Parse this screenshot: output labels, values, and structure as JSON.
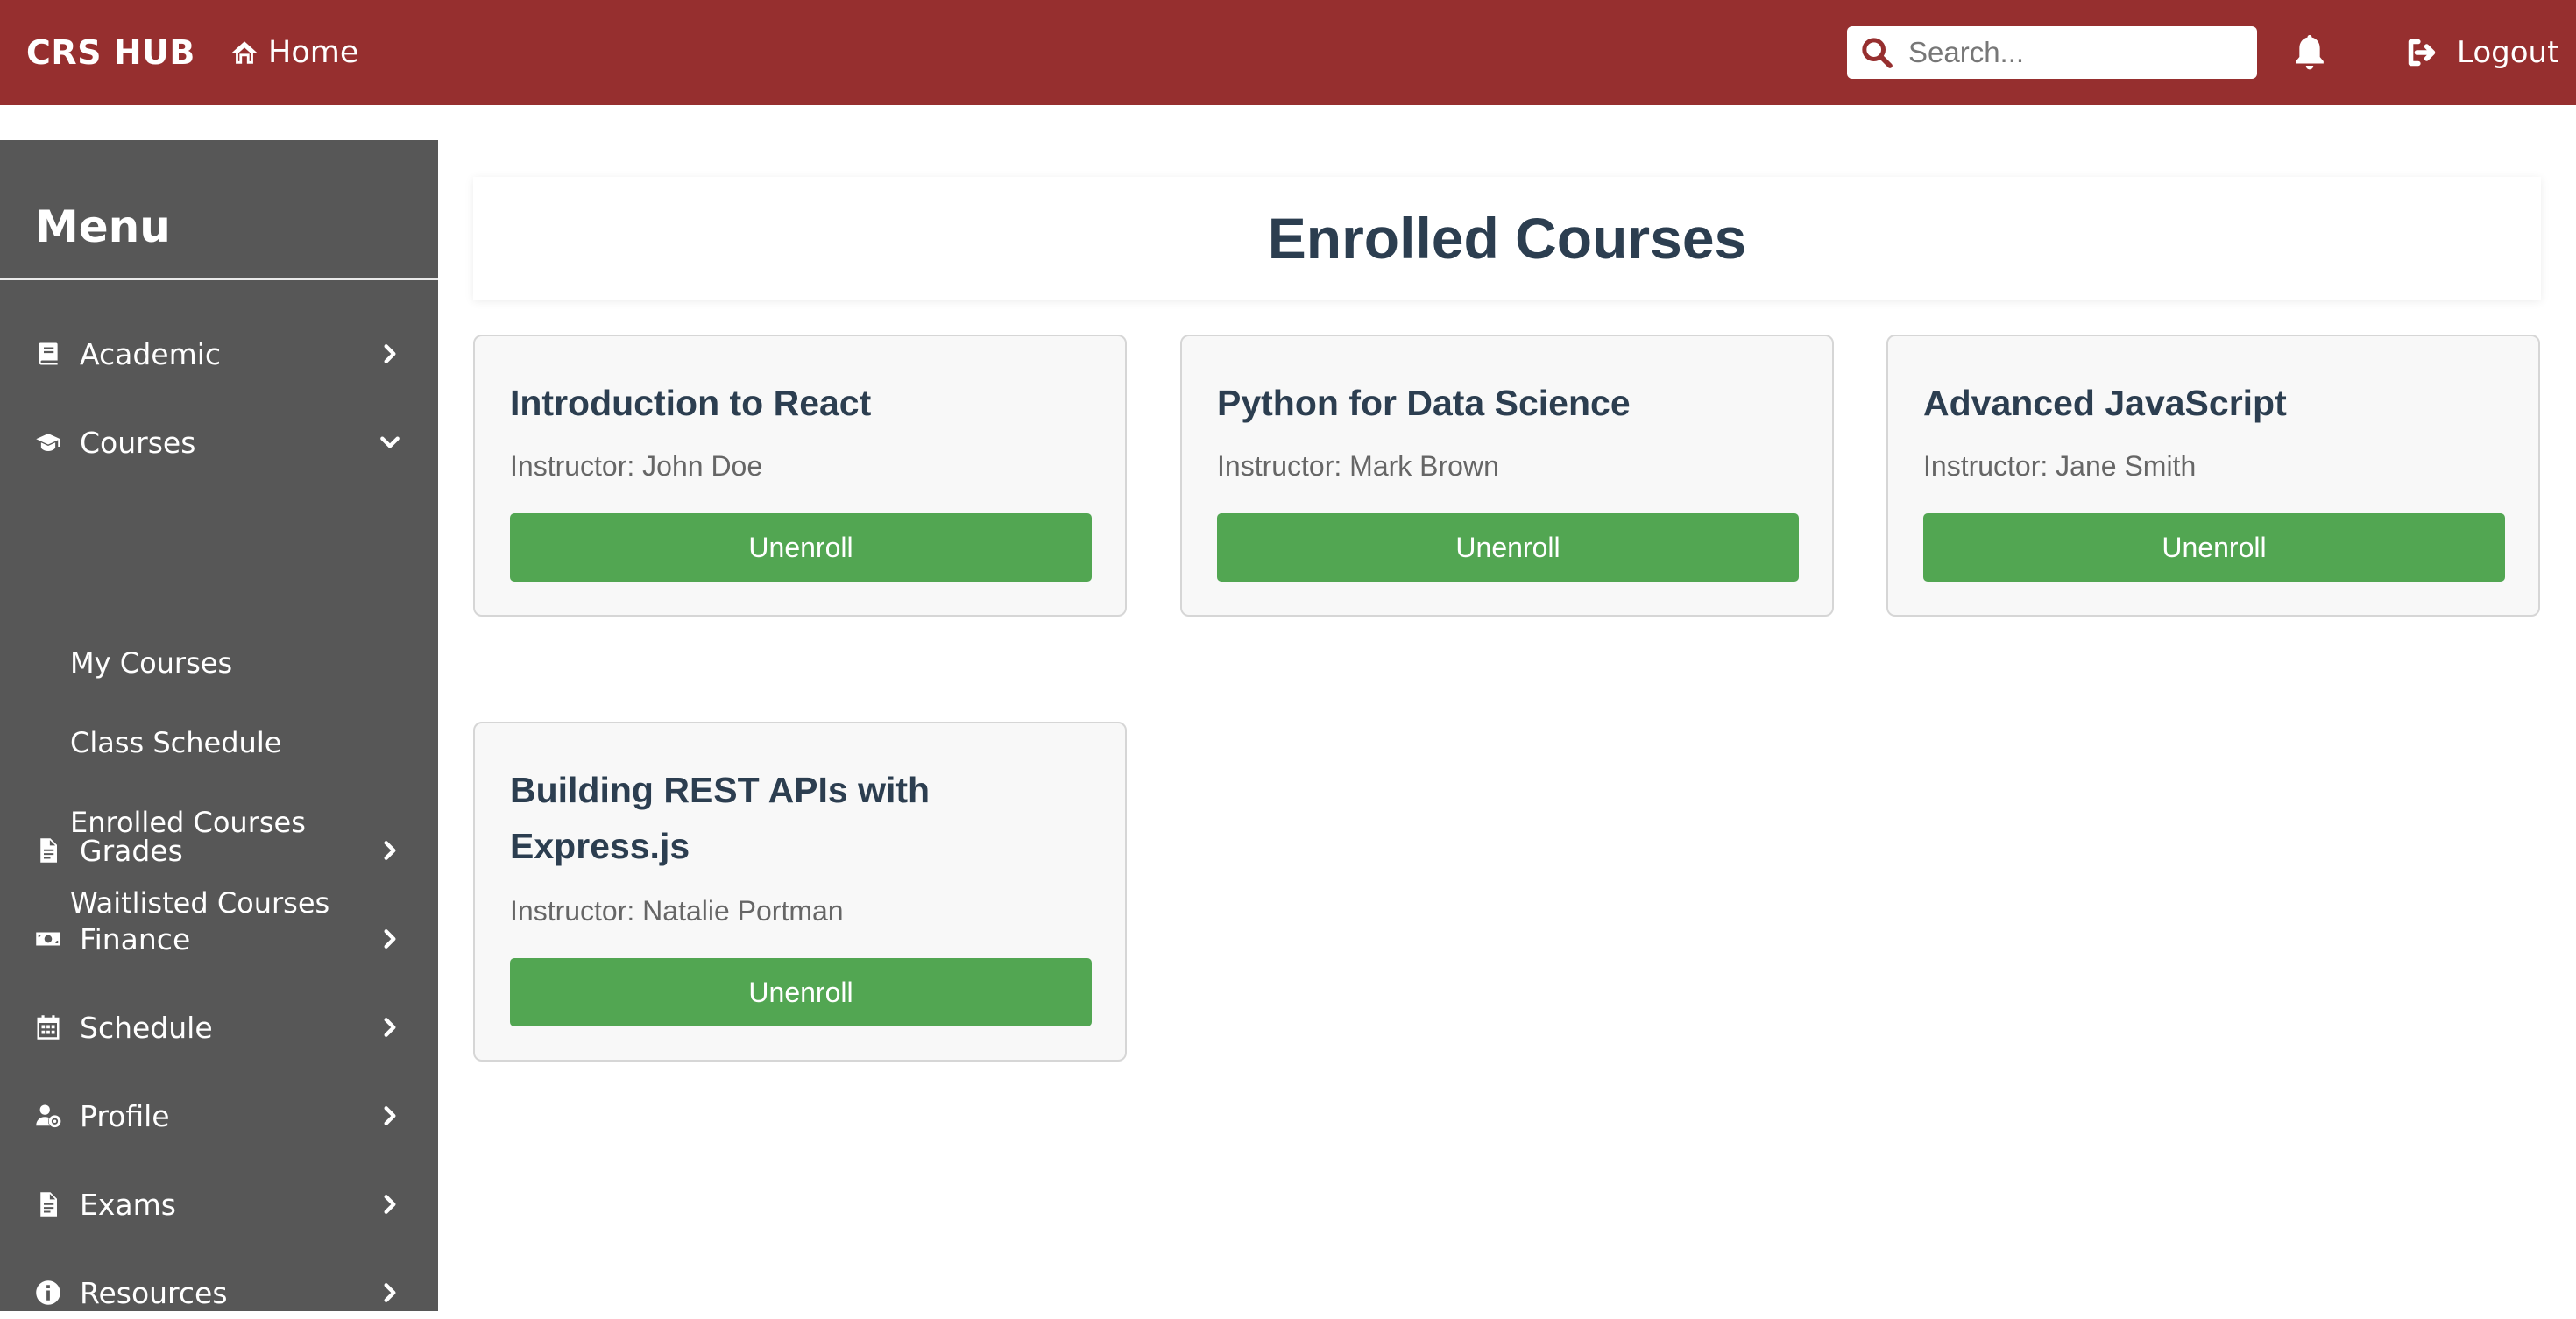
{
  "app": {
    "brand": "CRS HUB",
    "home_label": "Home"
  },
  "search": {
    "placeholder": "Search...",
    "value": ""
  },
  "logout_label": "Logout",
  "sidebar": {
    "title": "Menu",
    "items": [
      {
        "label": "Academic",
        "icon": "book-icon",
        "state": "collapsed"
      },
      {
        "label": "Courses",
        "icon": "graduation-cap-icon",
        "state": "expanded",
        "subitems": [
          "My Courses",
          "Class Schedule",
          "Enrolled Courses",
          "Waitlisted Courses"
        ]
      },
      {
        "label": "Grades",
        "icon": "document-icon",
        "state": "collapsed"
      },
      {
        "label": "Finance",
        "icon": "money-icon",
        "state": "collapsed"
      },
      {
        "label": "Schedule",
        "icon": "calendar-icon",
        "state": "collapsed"
      },
      {
        "label": "Profile",
        "icon": "user-gear-icon",
        "state": "collapsed"
      },
      {
        "label": "Exams",
        "icon": "document-icon",
        "state": "collapsed"
      },
      {
        "label": "Resources",
        "icon": "info-icon",
        "state": "collapsed"
      }
    ]
  },
  "main": {
    "title": "Enrolled Courses",
    "courses": [
      {
        "title": "Introduction to React",
        "instructor": "Instructor: John Doe",
        "action": "Unenroll"
      },
      {
        "title": "Python for Data Science",
        "instructor": "Instructor: Mark Brown",
        "action": "Unenroll"
      },
      {
        "title": "Advanced JavaScript",
        "instructor": "Instructor: Jane Smith",
        "action": "Unenroll"
      },
      {
        "title": "Building REST APIs with Express.js",
        "instructor": "Instructor: Natalie Portman",
        "action": "Unenroll"
      }
    ]
  },
  "colors": {
    "topbar": "#962f2f",
    "sidebar": "#575757",
    "button": "#52a652",
    "heading": "#2c3e50"
  }
}
